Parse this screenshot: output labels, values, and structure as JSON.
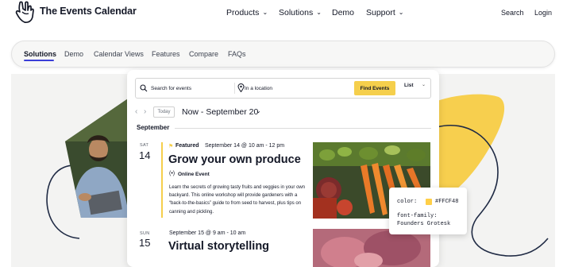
{
  "brand": {
    "name": "The Events Calendar",
    "logo_icon": "rock-hand-icon"
  },
  "main_nav": {
    "items": [
      {
        "label": "Products",
        "has_dropdown": true
      },
      {
        "label": "Solutions",
        "has_dropdown": true
      },
      {
        "label": "Demo",
        "has_dropdown": false
      },
      {
        "label": "Support",
        "has_dropdown": true
      }
    ],
    "search_label": "Search",
    "login_label": "Login"
  },
  "sub_nav": {
    "items": [
      "Solutions",
      "Demo",
      "Calendar Views",
      "Features",
      "Compare",
      "FAQs"
    ],
    "active": "Solutions"
  },
  "calendar": {
    "search_placeholder": "Search for events",
    "location_placeholder": "In a location",
    "find_button": "Find Events",
    "view_select": "List",
    "today_button": "Today",
    "date_range": "Now - September 20",
    "month_label": "September",
    "events": [
      {
        "dow": "SAT",
        "day": "14",
        "featured_label": "Featured",
        "time": "September 14 @ 10 am - 12 pm",
        "title": "Grow your own produce",
        "online_label": "Online Event",
        "description": "Learn the secrets of growing tasty fruits and veggies in your own backyard. This online workshop will provide gardeners with a “back-to-the-basics” guide to from seed to harvest, plus tips on canning and pickling."
      },
      {
        "dow": "SUN",
        "day": "15",
        "time": "September 15 @ 9 am - 10 am",
        "title": "Virtual storytelling"
      }
    ]
  },
  "style_card": {
    "color_label": "color:",
    "color_value": "#FFCF48",
    "font_label": "font-family:",
    "font_value": "Founders Grotesk"
  },
  "colors": {
    "accent_yellow": "#f5cf4c",
    "active_underline": "#3a3ed8",
    "text": "#141827"
  }
}
